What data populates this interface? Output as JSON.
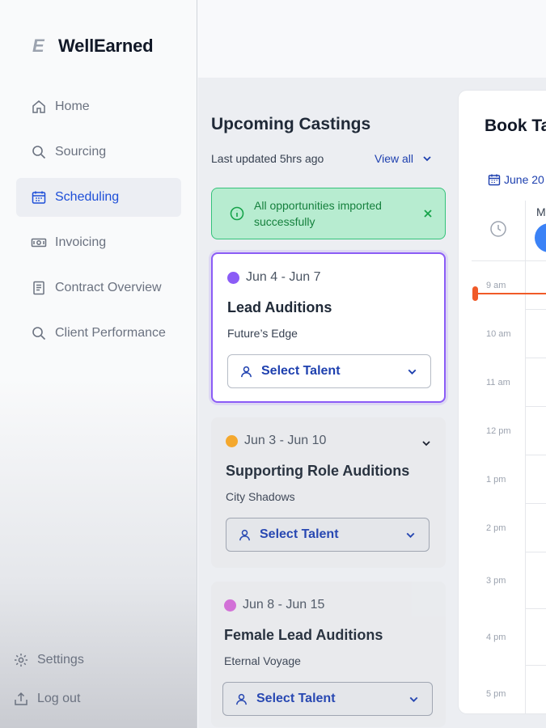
{
  "brand": {
    "name": "WellEarned",
    "mark": "E"
  },
  "sidebar": {
    "items": [
      {
        "label": "Home",
        "icon": "home-icon",
        "active": false
      },
      {
        "label": "Sourcing",
        "icon": "search-icon",
        "active": false
      },
      {
        "label": "Scheduling",
        "icon": "calendar-icon",
        "active": true
      },
      {
        "label": "Invoicing",
        "icon": "banknote-icon",
        "active": false
      },
      {
        "label": "Contract Overview",
        "icon": "document-icon",
        "active": false
      },
      {
        "label": "Client Performance",
        "icon": "search-icon",
        "active": false
      }
    ],
    "bottom": [
      {
        "label": "Settings",
        "icon": "gear-icon"
      },
      {
        "label": "Log out",
        "icon": "logout-icon"
      }
    ]
  },
  "castings": {
    "title": "Upcoming Castings",
    "updated": "Last updated 5hrs ago",
    "view_all": "View all",
    "alert": "All opportunities imported successfully",
    "cards": [
      {
        "dates": "Jun 4 - Jun 7",
        "dot_color": "#8b5cf6",
        "title": "Lead Auditions",
        "subtitle": "Future’s Edge",
        "button": "Select Talent"
      },
      {
        "dates": "Jun 3 - Jun 10",
        "dot_color": "#f5a524",
        "title": "Supporting Role Auditions",
        "subtitle": "City Shadows",
        "button": "Select Talent"
      },
      {
        "dates": "Jun 8 - Jun 15",
        "dot_color": "#d16bd6",
        "title": "Female Lead Auditions",
        "subtitle": "Eternal Voyage",
        "button": "Select Talent"
      }
    ]
  },
  "calendar": {
    "title": "Book Ta",
    "month": "June 20",
    "day_label": "M",
    "times": [
      "9 am",
      "10 am",
      "11 am",
      "12 pm",
      "1 pm",
      "2 pm",
      "3 pm",
      "4 pm",
      "5 pm"
    ]
  },
  "colors": {
    "accent": "#1e40af",
    "selected_border": "#8b5cf6",
    "success_bg": "#b7ecd0",
    "now_line": "#f05a28"
  }
}
